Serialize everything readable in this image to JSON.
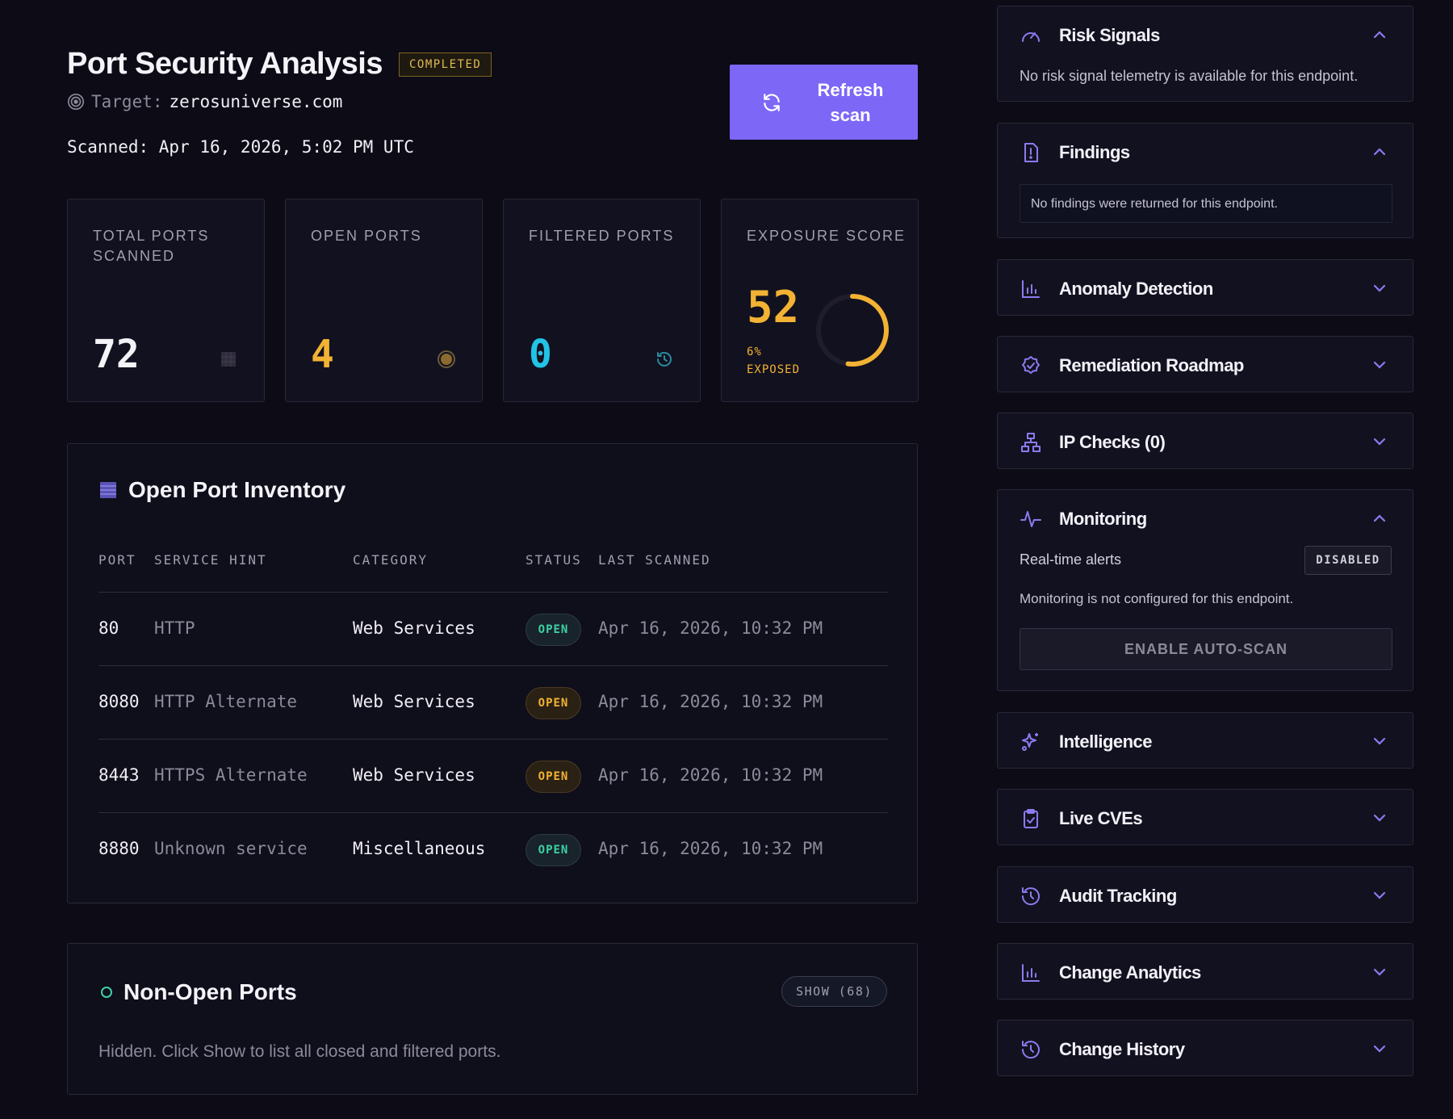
{
  "header": {
    "title": "Port Security Analysis",
    "status_badge": "COMPLETED",
    "target_label": "Target:",
    "target_value": "zerosuniverse.com",
    "scanned": "Scanned: Apr 16, 2026, 5:02 PM UTC",
    "refresh_label": "Refresh scan"
  },
  "stats": {
    "total": {
      "label": "TOTAL PORTS SCANNED",
      "value": "72"
    },
    "open": {
      "label": "OPEN PORTS",
      "value": "4"
    },
    "filtered": {
      "label": "FILTERED PORTS",
      "value": "0"
    },
    "exposure": {
      "label": "EXPOSURE SCORE",
      "value": "52",
      "pct_line1": "6%",
      "pct_line2": "EXPOSED",
      "gauge_fraction": 0.52
    }
  },
  "colors": {
    "accent": "#7d67f7",
    "amber": "#f2b233",
    "green": "#3dd1a4",
    "cyan": "#22c3e6"
  },
  "inventory": {
    "title": "Open Port Inventory",
    "columns": [
      "PORT",
      "SERVICE HINT",
      "CATEGORY",
      "STATUS",
      "LAST SCANNED"
    ],
    "rows": [
      {
        "port": "80",
        "hint": "HTTP",
        "category": "Web Services",
        "status": "OPEN",
        "status_tone": "green",
        "last": "Apr 16, 2026, 10:32 PM"
      },
      {
        "port": "8080",
        "hint": "HTTP Alternate",
        "category": "Web Services",
        "status": "OPEN",
        "status_tone": "amber",
        "last": "Apr 16, 2026, 10:32 PM"
      },
      {
        "port": "8443",
        "hint": "HTTPS Alternate",
        "category": "Web Services",
        "status": "OPEN",
        "status_tone": "amber",
        "last": "Apr 16, 2026, 10:32 PM"
      },
      {
        "port": "8880",
        "hint": "Unknown service",
        "category": "Miscellaneous",
        "status": "OPEN",
        "status_tone": "green",
        "last": "Apr 16, 2026, 10:32 PM"
      }
    ]
  },
  "nonopen": {
    "title": "Non-Open Ports",
    "show_label": "SHOW (68)",
    "description": "Hidden. Click Show to list all closed and filtered ports."
  },
  "sidebar": {
    "risk": {
      "title": "Risk Signals",
      "text": "No risk signal telemetry is available for this endpoint."
    },
    "findings": {
      "title": "Findings",
      "text": "No findings were returned for this endpoint."
    },
    "anomaly": {
      "title": "Anomaly Detection"
    },
    "remediation": {
      "title": "Remediation Roadmap"
    },
    "ipchecks": {
      "title": "IP Checks (0)"
    },
    "monitoring": {
      "title": "Monitoring",
      "alerts_label": "Real-time alerts",
      "alerts_badge": "DISABLED",
      "text": "Monitoring is not configured for this endpoint.",
      "button": "ENABLE AUTO-SCAN"
    },
    "intelligence": {
      "title": "Intelligence"
    },
    "cves": {
      "title": "Live CVEs"
    },
    "audit": {
      "title": "Audit Tracking"
    },
    "change_analytics": {
      "title": "Change Analytics"
    },
    "change_history": {
      "title": "Change History"
    }
  }
}
